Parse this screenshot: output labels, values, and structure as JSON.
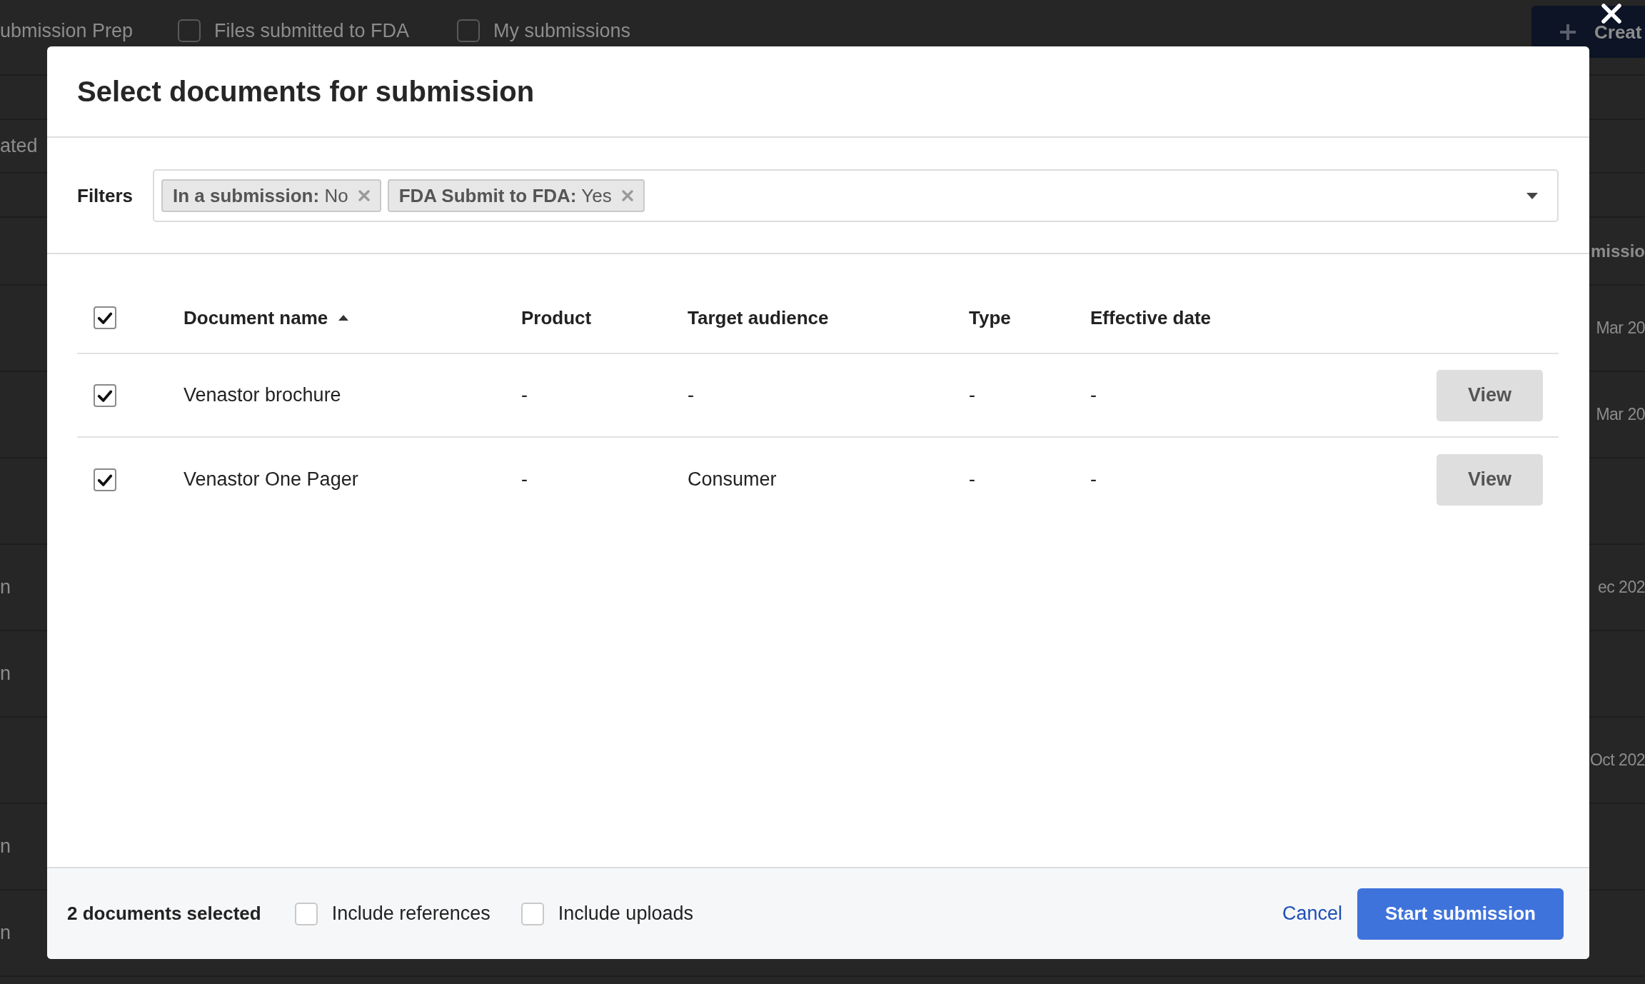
{
  "background_page": {
    "tabs": [
      {
        "label": "ubmission Prep"
      },
      {
        "label": "Files submitted to FDA",
        "checked": false
      },
      {
        "label": "My submissions",
        "checked": false
      }
    ],
    "create_button": "Creat",
    "section_label": "ated",
    "table": {
      "column_header": "missio",
      "rows": [
        {
          "last_column": "Mar 20"
        },
        {
          "last_column": "Mar 20"
        },
        {},
        {
          "first_column": "n",
          "last_column": "ec 202"
        },
        {
          "first_column": "n"
        },
        {
          "last_column": "Oct 202"
        },
        {
          "first_column": "n"
        },
        {
          "first_column": "n"
        }
      ]
    }
  },
  "dialog": {
    "title": "Select documents for submission",
    "filters": {
      "label": "Filters",
      "chips": [
        {
          "text": "**In a submission:** No"
        },
        {
          "text": "**FDA Submit to FDA:** Yes"
        }
      ]
    },
    "table": {
      "all_checked": true,
      "columns": [
        {
          "label": "Document name",
          "sorted": true
        },
        {
          "label": "Product",
          "sorted": false
        },
        {
          "label": "Target audience",
          "sorted": false
        },
        {
          "label": "Type",
          "sorted": false
        },
        {
          "label": "Effective date",
          "sorted": false
        }
      ],
      "rows": [
        {
          "checked": true,
          "cells": [
            "Venastor brochure",
            "-",
            "-",
            "-",
            "-"
          ],
          "action": "View"
        },
        {
          "checked": true,
          "cells": [
            "Venastor One Pager",
            "-",
            "Consumer",
            "-",
            "-"
          ],
          "action": "View"
        }
      ]
    },
    "footer": {
      "selection": "2 documents selected",
      "options": [
        {
          "label": "Include references",
          "checked": false
        },
        {
          "label": "Include uploads",
          "checked": false
        }
      ],
      "cancel": "Cancel",
      "submit": "Start submission"
    }
  }
}
